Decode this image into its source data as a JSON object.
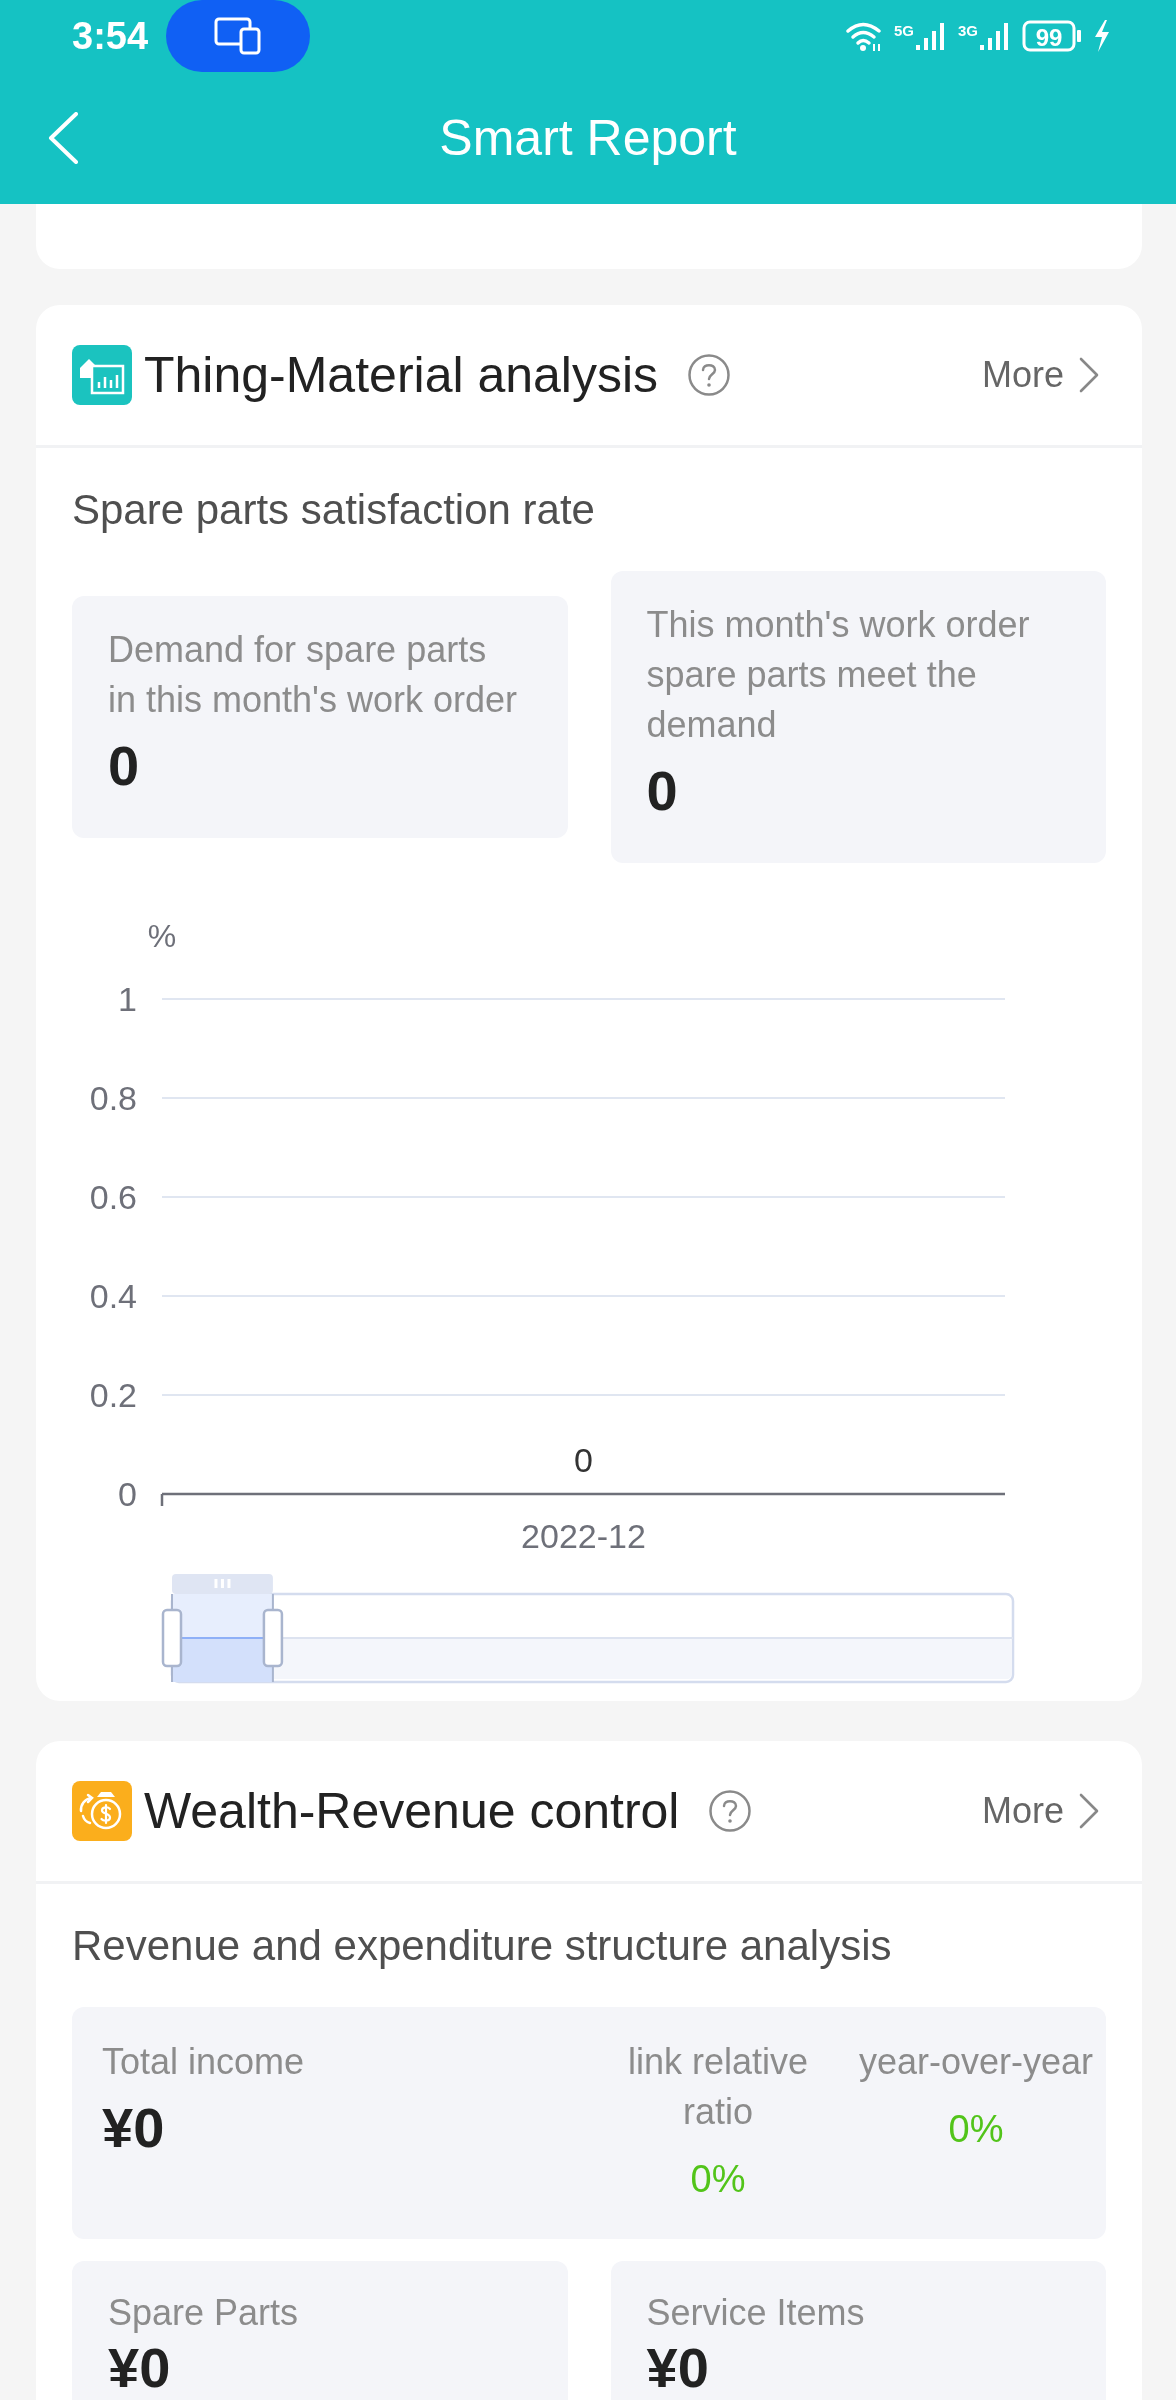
{
  "status_bar": {
    "time": "3:54",
    "network_1": "5G",
    "network_2": "3G",
    "battery": "99"
  },
  "header": {
    "title": "Smart Report"
  },
  "sections": [
    {
      "kind": "chart",
      "title": "Thing-Material analysis",
      "more": "More",
      "subtitle": "Spare parts satisfaction rate",
      "stats": [
        {
          "label": "Demand for spare parts in this month's work order",
          "value": "0"
        },
        {
          "label": "This month's work order spare parts meet the demand",
          "value": "0"
        }
      ],
      "chart_data": {
        "type": "bar",
        "ylabel": "%",
        "categories": [
          "2022-12"
        ],
        "values": [
          0
        ],
        "ylim": [
          0,
          1
        ],
        "yticks": [
          0,
          0.2,
          0.4,
          0.6,
          0.8,
          1
        ],
        "grid": true,
        "data_labels": true
      },
      "zoom_slider": {
        "level": 0.12
      }
    },
    {
      "kind": "finance",
      "title": "Wealth-Revenue control",
      "more": "More",
      "subtitle": "Revenue and expenditure structure analysis",
      "total": {
        "label": "Total income",
        "value": "¥0",
        "comparisons": [
          {
            "label": "link relative ratio",
            "value": "0%"
          },
          {
            "label": "year-over-year",
            "value": "0%"
          }
        ]
      },
      "items": [
        {
          "label": "Spare Parts",
          "value": "¥0"
        },
        {
          "label": "Service Items",
          "value": "¥0"
        }
      ]
    }
  ]
}
